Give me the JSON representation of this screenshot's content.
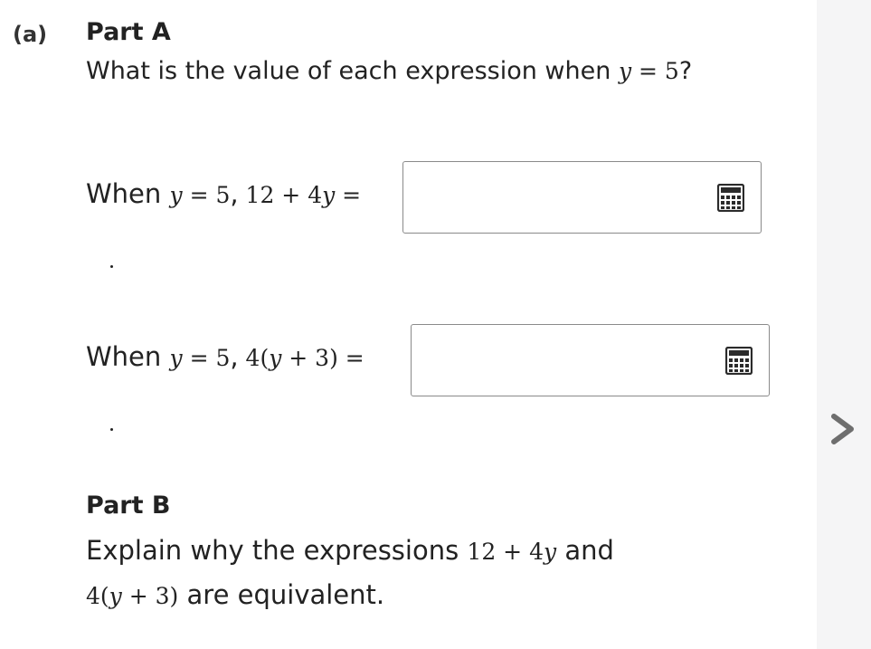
{
  "question": {
    "label": "(a)",
    "part_a": {
      "heading": "Part A",
      "prompt_text": "What is the value of each expression when ",
      "prompt_var": "y",
      "prompt_rest": " = 5",
      "prompt_end": "?",
      "rows": [
        {
          "lead": "When ",
          "cond_var": "y",
          "cond_rest": " = 5",
          "comma": ",",
          "expr_a": " 12 + 4",
          "expr_var": "y",
          "expr_b": " =",
          "value": "",
          "trail": "."
        },
        {
          "lead": "When ",
          "cond_var": "y",
          "cond_rest": " = 5",
          "comma": ",",
          "expr_a": " 4(",
          "expr_var": "y",
          "expr_b": " + 3) =",
          "value": "",
          "trail": "."
        }
      ]
    },
    "part_b": {
      "heading": "Part B",
      "line1_text": "Explain why the expressions ",
      "line1_math_a": "12 + 4",
      "line1_math_var": "y",
      "line1_end": " and",
      "line2_math_a": "4(",
      "line2_math_var": "y",
      "line2_math_b": " + 3)",
      "line2_end": " are equivalent."
    }
  },
  "icons": {
    "calculator": "calculator-icon",
    "next": "chevron-right-icon"
  },
  "colors": {
    "sidebar": "#f5f5f6",
    "arrow": "#6e6e6e",
    "text": "#222222",
    "box_border": "#8a8a8a"
  }
}
